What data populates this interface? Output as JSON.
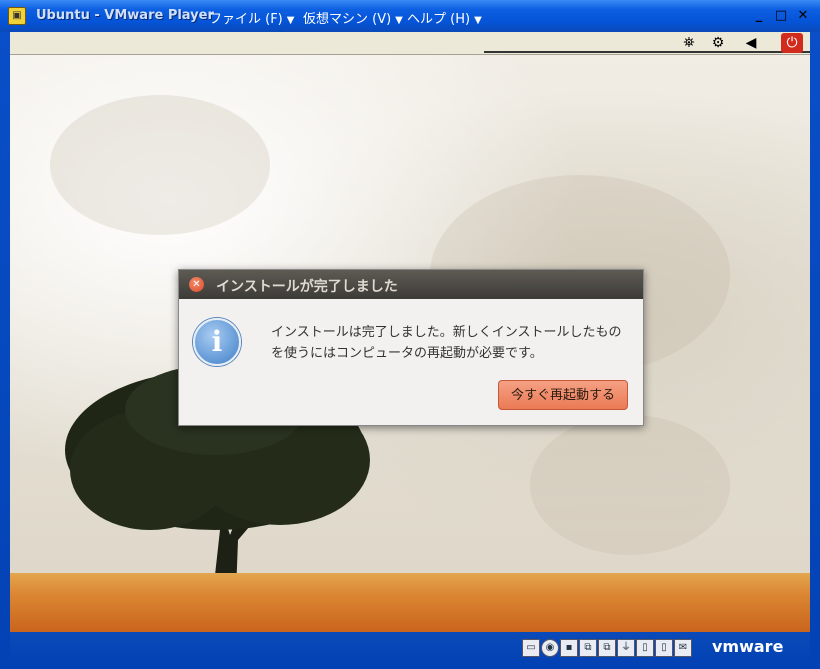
{
  "window": {
    "title": "Ubuntu - VMware Player",
    "menus": [
      {
        "label": "ファイル (F)"
      },
      {
        "label": "仮想マシン (V)"
      },
      {
        "label": "ヘルプ (H)"
      }
    ],
    "controls": {
      "minimize": "_",
      "maximize": "□",
      "close": "✕"
    }
  },
  "toolbar": {
    "icons": [
      "network-icon",
      "usb-icon",
      "sound-icon",
      "power-icon"
    ]
  },
  "dialog": {
    "title": "インストールが完了しました",
    "message_line1": "インストールは完了しました。新しくインストールしたもの",
    "message_line2": "を使うにはコンピュータの再起動が必要です。",
    "restart_button": "今すぐ再起動する",
    "icon": "info-icon"
  },
  "statusbar": {
    "brand": "vmware",
    "device_icons": [
      "hdd-icon",
      "cd-icon",
      "floppy-icon",
      "network-icon",
      "network-icon",
      "usb-icon",
      "sound-icon",
      "display-icon",
      "display-icon",
      "message-icon"
    ]
  },
  "colors": {
    "titlebar": "#0553d6",
    "dialog_header": "#3d3b37",
    "accent_button": "#ea7a55",
    "ground": "#dc8733"
  }
}
